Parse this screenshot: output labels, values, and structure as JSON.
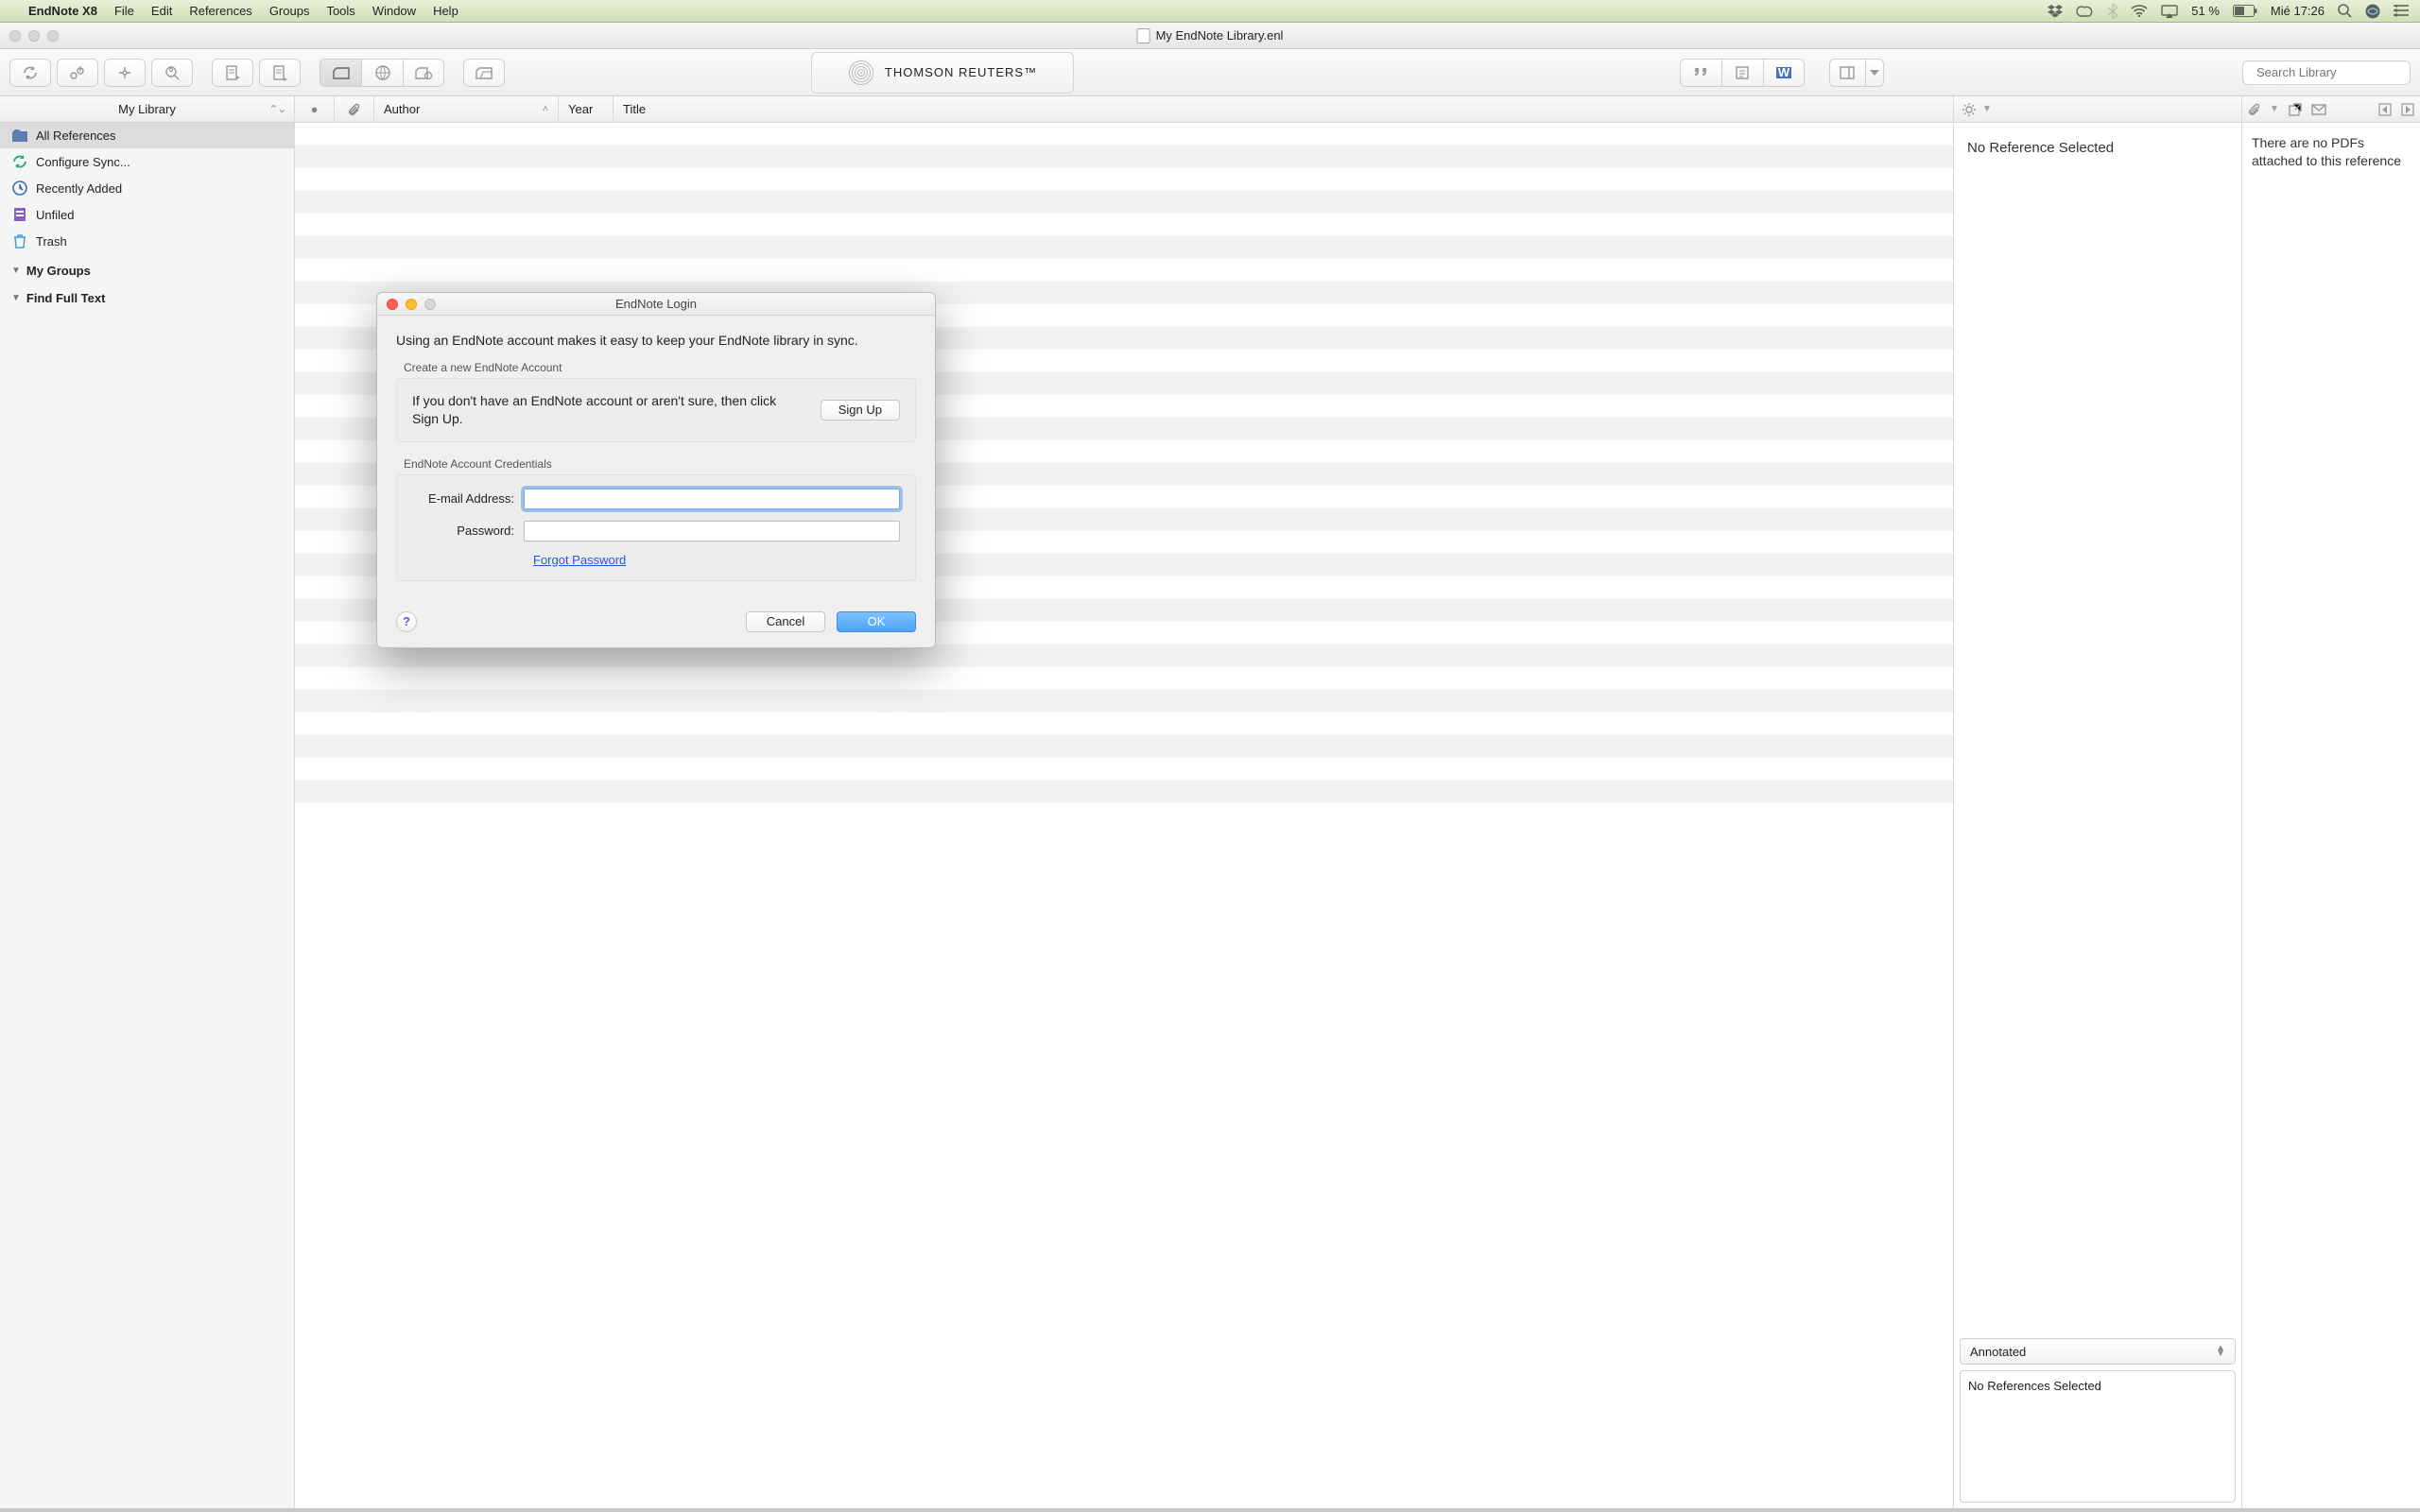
{
  "menubar": {
    "app_name": "EndNote X8",
    "items": [
      "File",
      "Edit",
      "References",
      "Groups",
      "Tools",
      "Window",
      "Help"
    ],
    "battery_pct": "51 %",
    "clock": "Mié 17:26"
  },
  "window": {
    "title": "My EndNote Library.enl"
  },
  "toolbar": {
    "logo_text": "THOMSON REUTERS™",
    "search_placeholder": "Search Library"
  },
  "sidebar": {
    "header": "My Library",
    "items": [
      {
        "label": "All References",
        "icon": "folder",
        "selected": true
      },
      {
        "label": "Configure Sync...",
        "icon": "sync"
      },
      {
        "label": "Recently Added",
        "icon": "clock"
      },
      {
        "label": "Unfiled",
        "icon": "stack"
      },
      {
        "label": "Trash",
        "icon": "trash"
      }
    ],
    "groups_label": "My Groups",
    "fulltext_label": "Find Full Text"
  },
  "reflist": {
    "cols": {
      "dot": "●",
      "clip": "",
      "author": "Author",
      "year": "Year",
      "title": "Title"
    }
  },
  "preview": {
    "no_ref": "No Reference Selected",
    "annotated": "Annotated",
    "no_refs_selected": "No References Selected"
  },
  "pdfpane": {
    "msg": "There are no PDFs attached to this reference"
  },
  "dialog": {
    "title": "EndNote Login",
    "lead": "Using an EndNote account makes it easy to keep your EndNote library in sync.",
    "create_label": "Create a new EndNote Account",
    "signup_text": "If you don't have an EndNote account or aren't sure, then click Sign Up.",
    "signup_btn": "Sign Up",
    "creds_label": "EndNote Account Credentials",
    "email_label": "E-mail Address:",
    "password_label": "Password:",
    "email_value": "",
    "password_value": "",
    "forgot": "Forgot Password",
    "cancel": "Cancel",
    "ok": "OK",
    "help": "?"
  }
}
